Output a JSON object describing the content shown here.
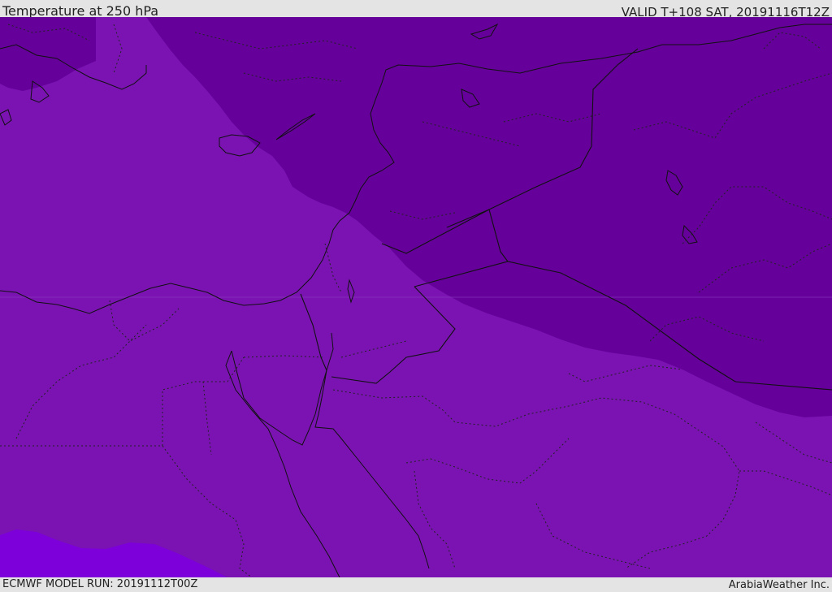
{
  "header": {
    "title": "Temperature at 250 hPa",
    "valid_time": "VALID T+108 SAT, 20191116T12Z"
  },
  "footer": {
    "model_run": "ECMWF MODEL RUN: 20191112T00Z",
    "credit": "ArabiaWeather Inc."
  },
  "colors": {
    "field_main": "#7a13b2",
    "field_cold": "#65009a",
    "field_warm": "#7d00da",
    "borders": "#111111",
    "bars": "#e4e4e4"
  }
}
